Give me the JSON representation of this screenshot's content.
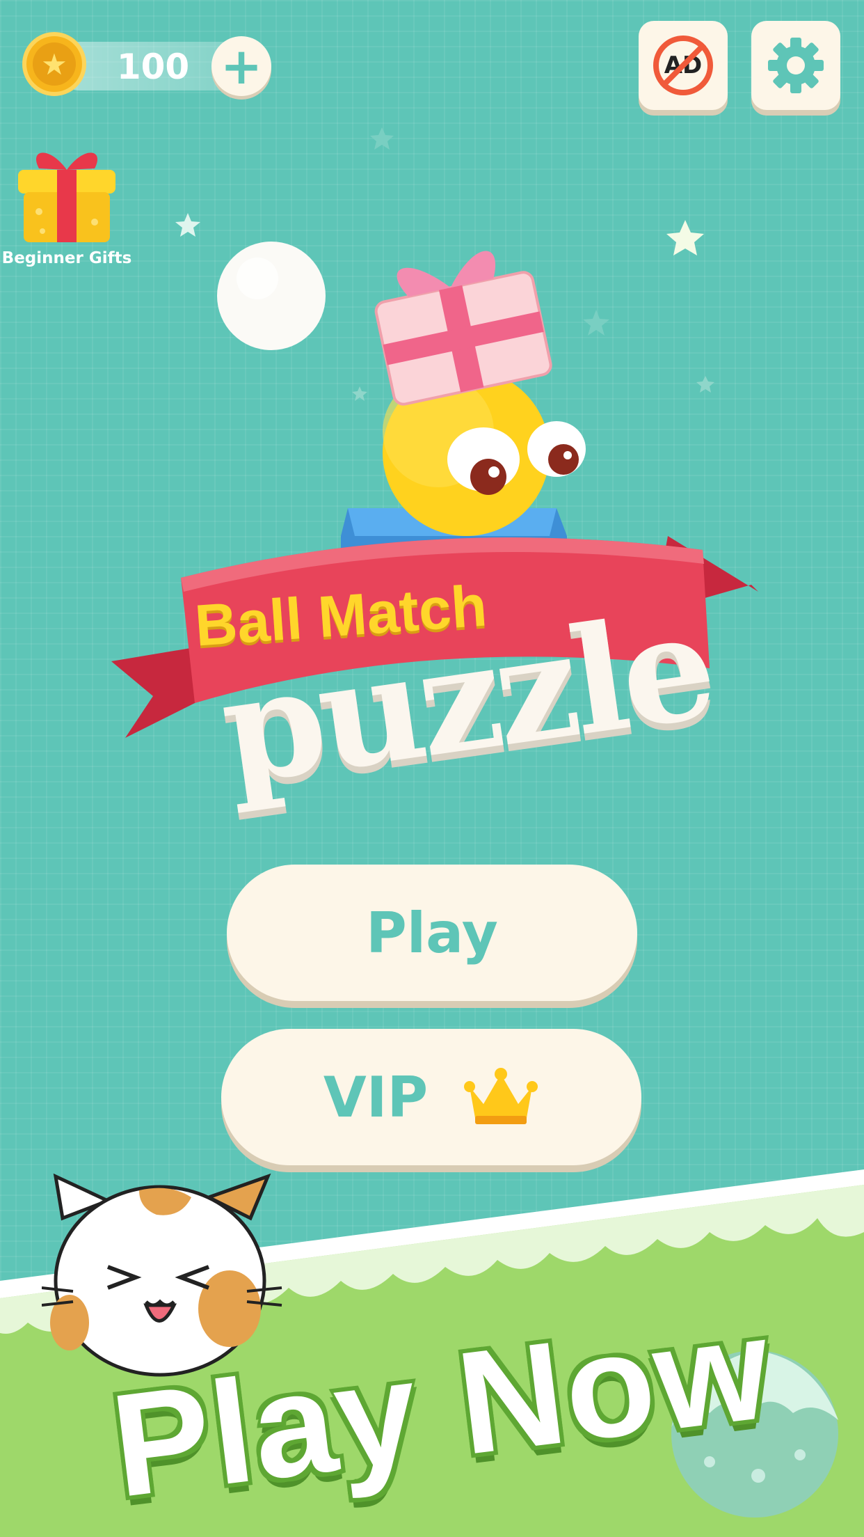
{
  "hud": {
    "coins": "100",
    "add_icon": "plus-icon",
    "coin_icon": "star-coin-icon",
    "no_ads_label": "AD",
    "settings_icon": "gear-icon"
  },
  "side": {
    "gift_label": "Beginner Gifts",
    "gift_icon": "gift-box-icon"
  },
  "logo": {
    "line1": "Ball Match",
    "line2": "puzzle"
  },
  "menu": {
    "play_label": "Play",
    "vip_label": "VIP",
    "vip_icon": "crown-icon"
  },
  "banner": {
    "text": "Play Now"
  },
  "colors": {
    "background": "#5ec5b7",
    "button": "#fdf6e8",
    "button_text": "#5ec5b7",
    "ribbon": "#e8445a",
    "logo_yellow": "#ffd62b",
    "grass": "#9ed86a"
  }
}
